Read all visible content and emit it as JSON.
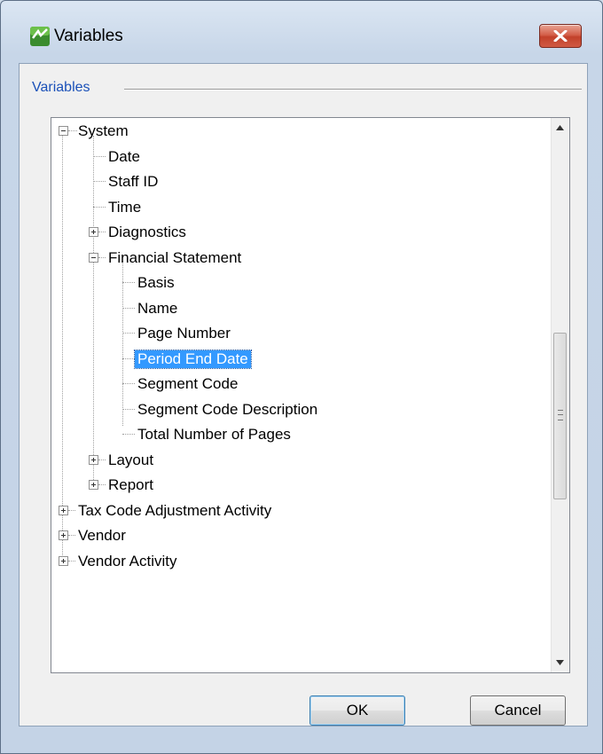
{
  "window": {
    "title": "Variables",
    "app_icon": "variables-app-icon",
    "close_icon": "close-x-icon"
  },
  "group": {
    "label": "Variables"
  },
  "tree": {
    "items": [
      {
        "label": "System",
        "expander": "minus"
      },
      {
        "label": "Date"
      },
      {
        "label": "Staff ID"
      },
      {
        "label": "Time"
      },
      {
        "label": "Diagnostics",
        "expander": "plus"
      },
      {
        "label": "Financial Statement",
        "expander": "minus"
      },
      {
        "label": "Basis"
      },
      {
        "label": "Name"
      },
      {
        "label": "Page Number"
      },
      {
        "label": "Period End Date",
        "selected": true
      },
      {
        "label": "Segment Code"
      },
      {
        "label": "Segment Code Description"
      },
      {
        "label": "Total Number of Pages"
      },
      {
        "label": "Layout",
        "expander": "plus"
      },
      {
        "label": "Report",
        "expander": "plus"
      },
      {
        "label": "Tax Code Adjustment Activity",
        "expander": "plus"
      },
      {
        "label": "Vendor",
        "expander": "plus"
      },
      {
        "label": "Vendor Activity",
        "expander": "plus"
      }
    ]
  },
  "buttons": {
    "ok": "OK",
    "cancel": "Cancel"
  },
  "colors": {
    "selection": "#3399ff",
    "group_label": "#1a50b8",
    "close_button": "#c2412a"
  }
}
